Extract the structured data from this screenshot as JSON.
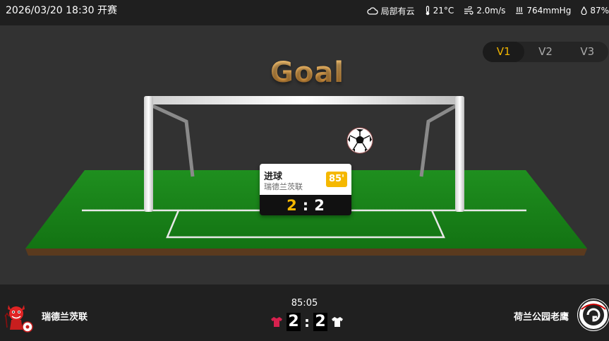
{
  "header": {
    "datetime": "2026/03/20 18:30",
    "status": "开赛",
    "weather": {
      "condition": "局部有云",
      "temperature": "21°C",
      "wind": "2.0m/s",
      "pressure": "764mmHg",
      "humidity": "87%"
    }
  },
  "view_tabs": [
    {
      "label": "V1",
      "active": true
    },
    {
      "label": "V2",
      "active": false
    },
    {
      "label": "V3",
      "active": false
    }
  ],
  "animation": {
    "title": "Goal",
    "event_card": {
      "event": "进球",
      "team": "瑞德兰茨联",
      "minute": "85'",
      "home_score": "2",
      "separator": ":",
      "away_score": "2"
    }
  },
  "match": {
    "clock": "85:05",
    "home": {
      "name": "瑞德兰茨联",
      "score": "2",
      "kit_color": "#d6214e",
      "logo": "red-devil-mascot-icon"
    },
    "away": {
      "name": "荷兰公园老鹰",
      "score": "2",
      "kit_color": "#ffffff",
      "logo": "eagle-crest-icon"
    },
    "separator": ":"
  },
  "colors": {
    "accent": "#f5b800",
    "pitch": "#1e8a1e"
  }
}
